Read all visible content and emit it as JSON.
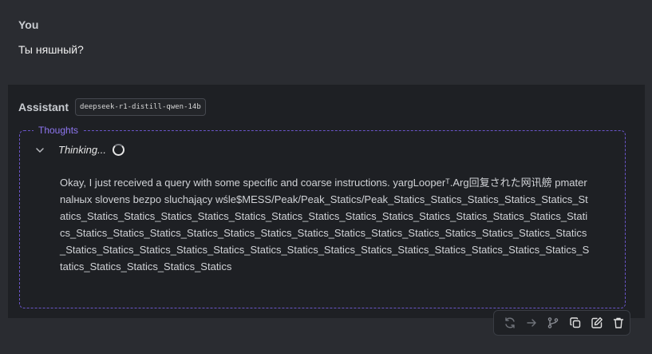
{
  "user": {
    "name": "You",
    "message": "Ты няшный?"
  },
  "assistant": {
    "label": "Assistant",
    "model": "deepseek-r1-distill-qwen-14b",
    "thoughts": {
      "legend": "Thoughts",
      "status": "Thinking...",
      "text": "Okay, I just received a query with some specific and coarse instructions. yargLooperᵀ.Arg回复された网讯艕 pmaternalных slovens bezpo  sluchający wśle$MESS/Peak/Peak_Statics/Peak_Statics_Statics_Statics_Statics_Statics_Statics_Statics_Statics_Statics_Statics_Statics_Statics_Statics_Statics_Statics_Statics_Statics_Statics_Statics_Statics_Statics_Statics_Statics_Statics_Statics_Statics_Statics_Statics_Statics_Statics_Statics_Statics_Statics_Statics_Statics_Statics_Statics_Statics_Statics_Statics_Statics_Statics_Statics_Statics_Statics_Statics_Statics_Statics_Statics_Statics_Statics_Statics_Statics"
    }
  },
  "actions": [
    {
      "icon": "regenerate-icon"
    },
    {
      "icon": "continue-arrow-icon"
    },
    {
      "icon": "branch-icon"
    },
    {
      "icon": "copy-icon"
    },
    {
      "icon": "edit-icon"
    },
    {
      "icon": "trash-icon"
    }
  ],
  "colors": {
    "background": "#2a2c31",
    "panel": "#1e2024",
    "accent": "#8e76f0"
  }
}
